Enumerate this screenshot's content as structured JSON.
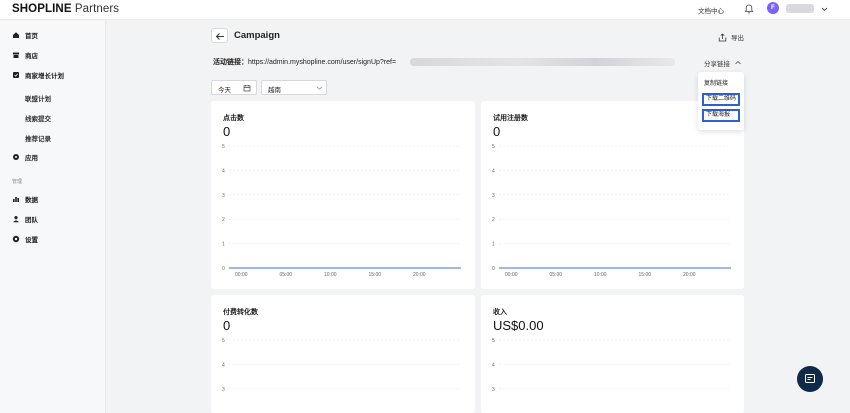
{
  "header": {
    "logo_brand": "SHOPLINE",
    "logo_suffix": " Partners",
    "doc_center": "文档中心",
    "avatar_initial": "F"
  },
  "sidebar": {
    "items": [
      {
        "label": "首页",
        "icon": "home-icon"
      },
      {
        "label": "商店",
        "icon": "store-icon"
      },
      {
        "label": "商家增长计划",
        "icon": "growth-plan-icon"
      },
      {
        "label": "联盟计划"
      },
      {
        "label": "线索提交"
      },
      {
        "label": "推荐记录"
      },
      {
        "label": "应用",
        "icon": "apps-icon"
      },
      {
        "label": "数据",
        "icon": "chart-icon"
      },
      {
        "label": "团队",
        "icon": "team-icon"
      },
      {
        "label": "设置",
        "icon": "settings-icon"
      }
    ],
    "section_manage": "管理"
  },
  "page": {
    "title": "Campaign",
    "export_label": "导出",
    "link_label": "活动链接：",
    "link_value": "https://admin.myshopline.com/user/signUp?ref=",
    "share_link": "分享链接",
    "date_filter": "今天",
    "region": "越南"
  },
  "dropdown": {
    "items": [
      "复制链接",
      "下载二维码",
      "下载海报"
    ]
  },
  "cards": [
    {
      "title": "点击数",
      "value": "0"
    },
    {
      "title": "试用注册数",
      "value": "0"
    },
    {
      "title": "付费转化数",
      "value": "0"
    },
    {
      "title": "收入",
      "value": "US$0.00"
    }
  ],
  "chart_data": [
    {
      "type": "line",
      "title": "点击数",
      "x": [
        "00:00",
        "05:00",
        "10:00",
        "15:00",
        "20:00"
      ],
      "series": [
        {
          "values": [
            0,
            0,
            0,
            0,
            0
          ]
        }
      ],
      "ylim": [
        0,
        5
      ],
      "yticks": [
        0,
        1,
        2,
        3,
        4,
        5
      ]
    },
    {
      "type": "line",
      "title": "试用注册数",
      "x": [
        "00:00",
        "05:00",
        "10:00",
        "15:00",
        "20:00"
      ],
      "series": [
        {
          "values": [
            0,
            0,
            0,
            0,
            0
          ]
        }
      ],
      "ylim": [
        0,
        5
      ],
      "yticks": [
        0,
        1,
        2,
        3,
        4,
        5
      ]
    },
    {
      "type": "line",
      "title": "付费转化数",
      "yticks": [
        3,
        4,
        5
      ]
    },
    {
      "type": "line",
      "title": "收入",
      "yticks": [
        3,
        4,
        5
      ]
    }
  ],
  "colors": {
    "accent": "#2f5fd6",
    "line": "#3d6be0",
    "avatar": "#7b61ff",
    "fab": "#122a4a"
  }
}
